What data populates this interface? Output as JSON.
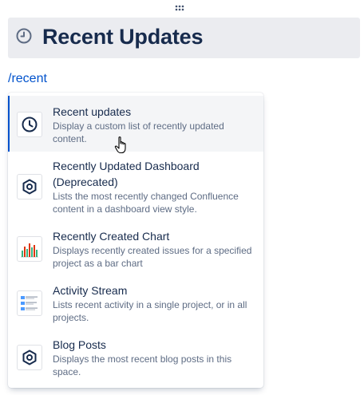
{
  "heading": {
    "icon": "clock-icon",
    "title": "Recent Updates"
  },
  "editor": {
    "slash_command": "/recent"
  },
  "menu": {
    "items": [
      {
        "title": "Recent updates",
        "description": "Display a custom list of recently updated content.",
        "icon": "clock-icon",
        "selected": true
      },
      {
        "title": "Recently Updated Dashboard (Deprecated)",
        "description": "Lists the most recently changed Confluence content in a dashboard view style.",
        "icon": "hexagon-icon",
        "selected": false
      },
      {
        "title": "Recently Created Chart",
        "description": "Displays recently created issues for a specified project as a bar chart",
        "icon": "bar-chart-icon",
        "selected": false
      },
      {
        "title": "Activity Stream",
        "description": "Lists recent activity in a single project, or in all projects.",
        "icon": "activity-stream-icon",
        "selected": false
      },
      {
        "title": "Blog Posts",
        "description": "Displays the most recent blog posts in this space.",
        "icon": "hexagon-icon",
        "selected": false
      }
    ]
  },
  "colors": {
    "accent": "#0052cc",
    "heading_bg": "#ebecf0",
    "selected_bg": "#f4f5f7",
    "text_primary": "#172b4d",
    "text_secondary": "#5e6c84"
  }
}
